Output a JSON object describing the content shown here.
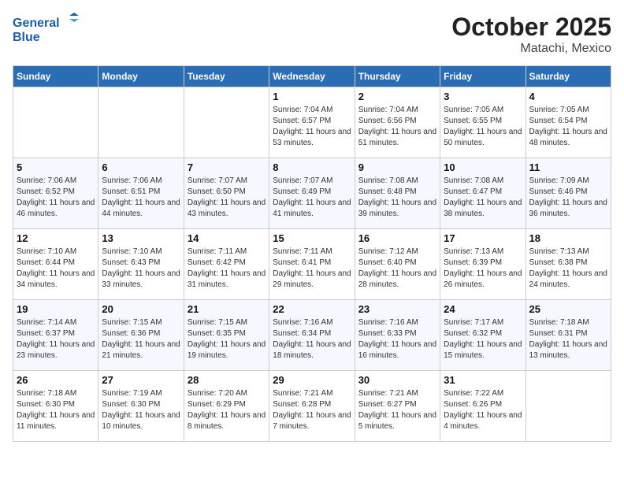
{
  "header": {
    "logo_text_general": "General",
    "logo_text_blue": "Blue",
    "month": "October 2025",
    "location": "Matachi, Mexico"
  },
  "days_of_week": [
    "Sunday",
    "Monday",
    "Tuesday",
    "Wednesday",
    "Thursday",
    "Friday",
    "Saturday"
  ],
  "weeks": [
    [
      {
        "day": "",
        "info": ""
      },
      {
        "day": "",
        "info": ""
      },
      {
        "day": "",
        "info": ""
      },
      {
        "day": "1",
        "info": "Sunrise: 7:04 AM\nSunset: 6:57 PM\nDaylight: 11 hours and 53 minutes."
      },
      {
        "day": "2",
        "info": "Sunrise: 7:04 AM\nSunset: 6:56 PM\nDaylight: 11 hours and 51 minutes."
      },
      {
        "day": "3",
        "info": "Sunrise: 7:05 AM\nSunset: 6:55 PM\nDaylight: 11 hours and 50 minutes."
      },
      {
        "day": "4",
        "info": "Sunrise: 7:05 AM\nSunset: 6:54 PM\nDaylight: 11 hours and 48 minutes."
      }
    ],
    [
      {
        "day": "5",
        "info": "Sunrise: 7:06 AM\nSunset: 6:52 PM\nDaylight: 11 hours and 46 minutes."
      },
      {
        "day": "6",
        "info": "Sunrise: 7:06 AM\nSunset: 6:51 PM\nDaylight: 11 hours and 44 minutes."
      },
      {
        "day": "7",
        "info": "Sunrise: 7:07 AM\nSunset: 6:50 PM\nDaylight: 11 hours and 43 minutes."
      },
      {
        "day": "8",
        "info": "Sunrise: 7:07 AM\nSunset: 6:49 PM\nDaylight: 11 hours and 41 minutes."
      },
      {
        "day": "9",
        "info": "Sunrise: 7:08 AM\nSunset: 6:48 PM\nDaylight: 11 hours and 39 minutes."
      },
      {
        "day": "10",
        "info": "Sunrise: 7:08 AM\nSunset: 6:47 PM\nDaylight: 11 hours and 38 minutes."
      },
      {
        "day": "11",
        "info": "Sunrise: 7:09 AM\nSunset: 6:46 PM\nDaylight: 11 hours and 36 minutes."
      }
    ],
    [
      {
        "day": "12",
        "info": "Sunrise: 7:10 AM\nSunset: 6:44 PM\nDaylight: 11 hours and 34 minutes."
      },
      {
        "day": "13",
        "info": "Sunrise: 7:10 AM\nSunset: 6:43 PM\nDaylight: 11 hours and 33 minutes."
      },
      {
        "day": "14",
        "info": "Sunrise: 7:11 AM\nSunset: 6:42 PM\nDaylight: 11 hours and 31 minutes."
      },
      {
        "day": "15",
        "info": "Sunrise: 7:11 AM\nSunset: 6:41 PM\nDaylight: 11 hours and 29 minutes."
      },
      {
        "day": "16",
        "info": "Sunrise: 7:12 AM\nSunset: 6:40 PM\nDaylight: 11 hours and 28 minutes."
      },
      {
        "day": "17",
        "info": "Sunrise: 7:13 AM\nSunset: 6:39 PM\nDaylight: 11 hours and 26 minutes."
      },
      {
        "day": "18",
        "info": "Sunrise: 7:13 AM\nSunset: 6:38 PM\nDaylight: 11 hours and 24 minutes."
      }
    ],
    [
      {
        "day": "19",
        "info": "Sunrise: 7:14 AM\nSunset: 6:37 PM\nDaylight: 11 hours and 23 minutes."
      },
      {
        "day": "20",
        "info": "Sunrise: 7:15 AM\nSunset: 6:36 PM\nDaylight: 11 hours and 21 minutes."
      },
      {
        "day": "21",
        "info": "Sunrise: 7:15 AM\nSunset: 6:35 PM\nDaylight: 11 hours and 19 minutes."
      },
      {
        "day": "22",
        "info": "Sunrise: 7:16 AM\nSunset: 6:34 PM\nDaylight: 11 hours and 18 minutes."
      },
      {
        "day": "23",
        "info": "Sunrise: 7:16 AM\nSunset: 6:33 PM\nDaylight: 11 hours and 16 minutes."
      },
      {
        "day": "24",
        "info": "Sunrise: 7:17 AM\nSunset: 6:32 PM\nDaylight: 11 hours and 15 minutes."
      },
      {
        "day": "25",
        "info": "Sunrise: 7:18 AM\nSunset: 6:31 PM\nDaylight: 11 hours and 13 minutes."
      }
    ],
    [
      {
        "day": "26",
        "info": "Sunrise: 7:18 AM\nSunset: 6:30 PM\nDaylight: 11 hours and 11 minutes."
      },
      {
        "day": "27",
        "info": "Sunrise: 7:19 AM\nSunset: 6:30 PM\nDaylight: 11 hours and 10 minutes."
      },
      {
        "day": "28",
        "info": "Sunrise: 7:20 AM\nSunset: 6:29 PM\nDaylight: 11 hours and 8 minutes."
      },
      {
        "day": "29",
        "info": "Sunrise: 7:21 AM\nSunset: 6:28 PM\nDaylight: 11 hours and 7 minutes."
      },
      {
        "day": "30",
        "info": "Sunrise: 7:21 AM\nSunset: 6:27 PM\nDaylight: 11 hours and 5 minutes."
      },
      {
        "day": "31",
        "info": "Sunrise: 7:22 AM\nSunset: 6:26 PM\nDaylight: 11 hours and 4 minutes."
      },
      {
        "day": "",
        "info": ""
      }
    ]
  ]
}
